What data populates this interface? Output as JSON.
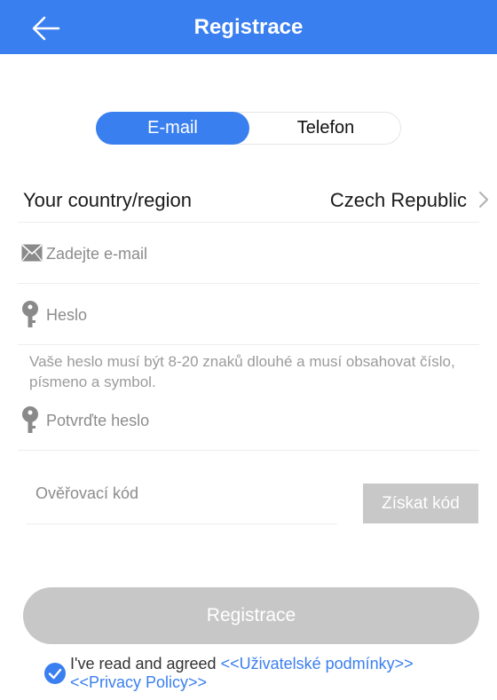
{
  "header": {
    "title": "Registrace",
    "back_icon": "arrow-left-icon"
  },
  "tabs": [
    {
      "label": "E-mail",
      "active": true
    },
    {
      "label": "Telefon",
      "active": false
    }
  ],
  "country": {
    "label": "Your country/region",
    "value": "Czech Republic"
  },
  "form": {
    "email_placeholder": "Zadejte e-mail",
    "password_placeholder": "Heslo",
    "password_hint": "Vaše heslo musí být 8-20 znaků dlouhé a musí obsahovat číslo, písmeno a symbol.",
    "confirm_placeholder": "Potvrďte heslo",
    "code_placeholder": "Ověřovací kód",
    "get_code_label": "Získat kód"
  },
  "submit_label": "Registrace",
  "agreement": {
    "text": "I've read and agreed ",
    "terms_link": "<<Uživatelské podmínky>>",
    "privacy_link": "<<Privacy Policy>>",
    "checked": true
  },
  "colors": {
    "accent": "#3a7ff0",
    "disabled": "#c7c7c7",
    "placeholder": "#8c8c8c"
  }
}
